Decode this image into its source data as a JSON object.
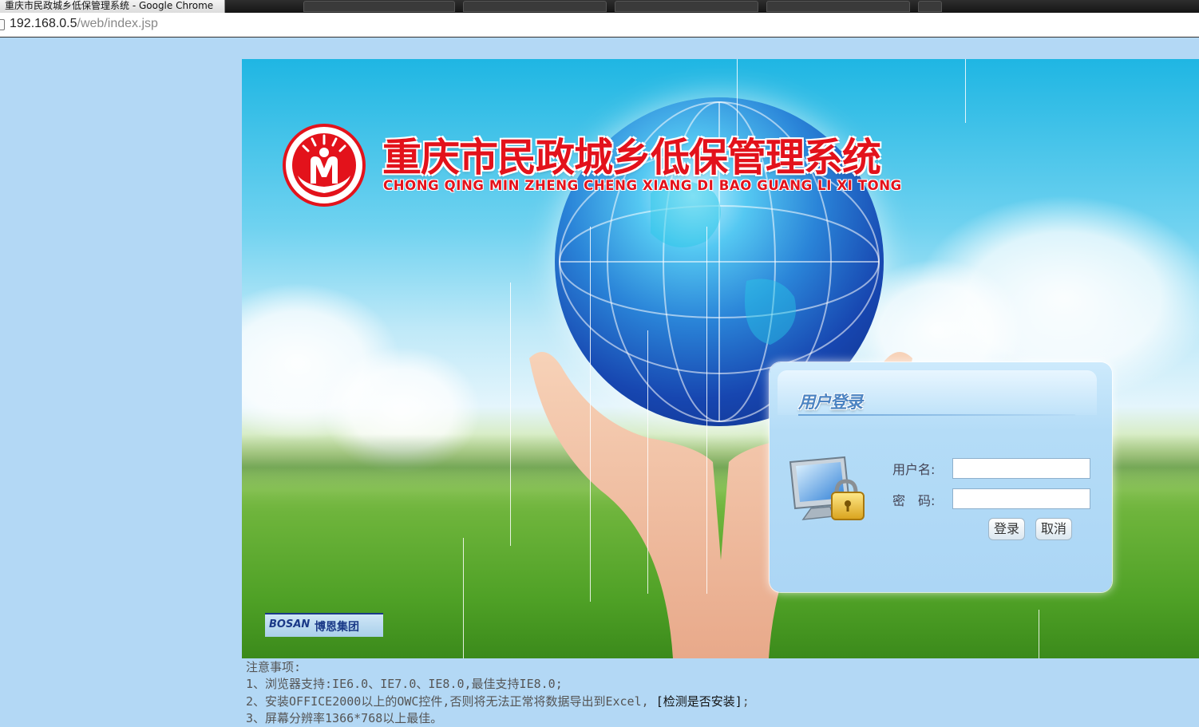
{
  "browser": {
    "window_title": "重庆市民政城乡低保管理系统 - Google Chrome",
    "url_host": "192.168.0.5",
    "url_path": "/web/index.jsp"
  },
  "banner": {
    "system_title": "重庆市民政城乡低保管理系统",
    "system_pinyin": "CHONG QING MIN ZHENG CHENG XIANG DI BAO GUANG LI XI TONG",
    "emblem_icon": "civil-affairs-emblem-icon",
    "company_logo_text": "BOSAN",
    "company_name": "博恩集团"
  },
  "login": {
    "title": "用户登录",
    "username_label": "用户名:",
    "username_value": "",
    "password_label": "密　码:",
    "password_value": "",
    "login_button": "登录",
    "cancel_button": "取消",
    "illustration_icon": "computer-lock-icon"
  },
  "notes": {
    "heading": "注意事项:",
    "line1": "1、浏览器支持:IE6.0、IE7.0、IE8.0,最佳支持IE8.0;",
    "line2_prefix": "2、安装OFFICE2000以上的OWC控件,否则将无法正常将数据导出到Excel,",
    "line2_link": "[检测是否安装]",
    "line2_suffix": ";",
    "line3": "3、屏幕分辨率1366*768以上最佳。"
  },
  "colors": {
    "page_background": "#b3d8f5",
    "title_red": "#e3121b",
    "login_panel": "#b4dcf7"
  }
}
